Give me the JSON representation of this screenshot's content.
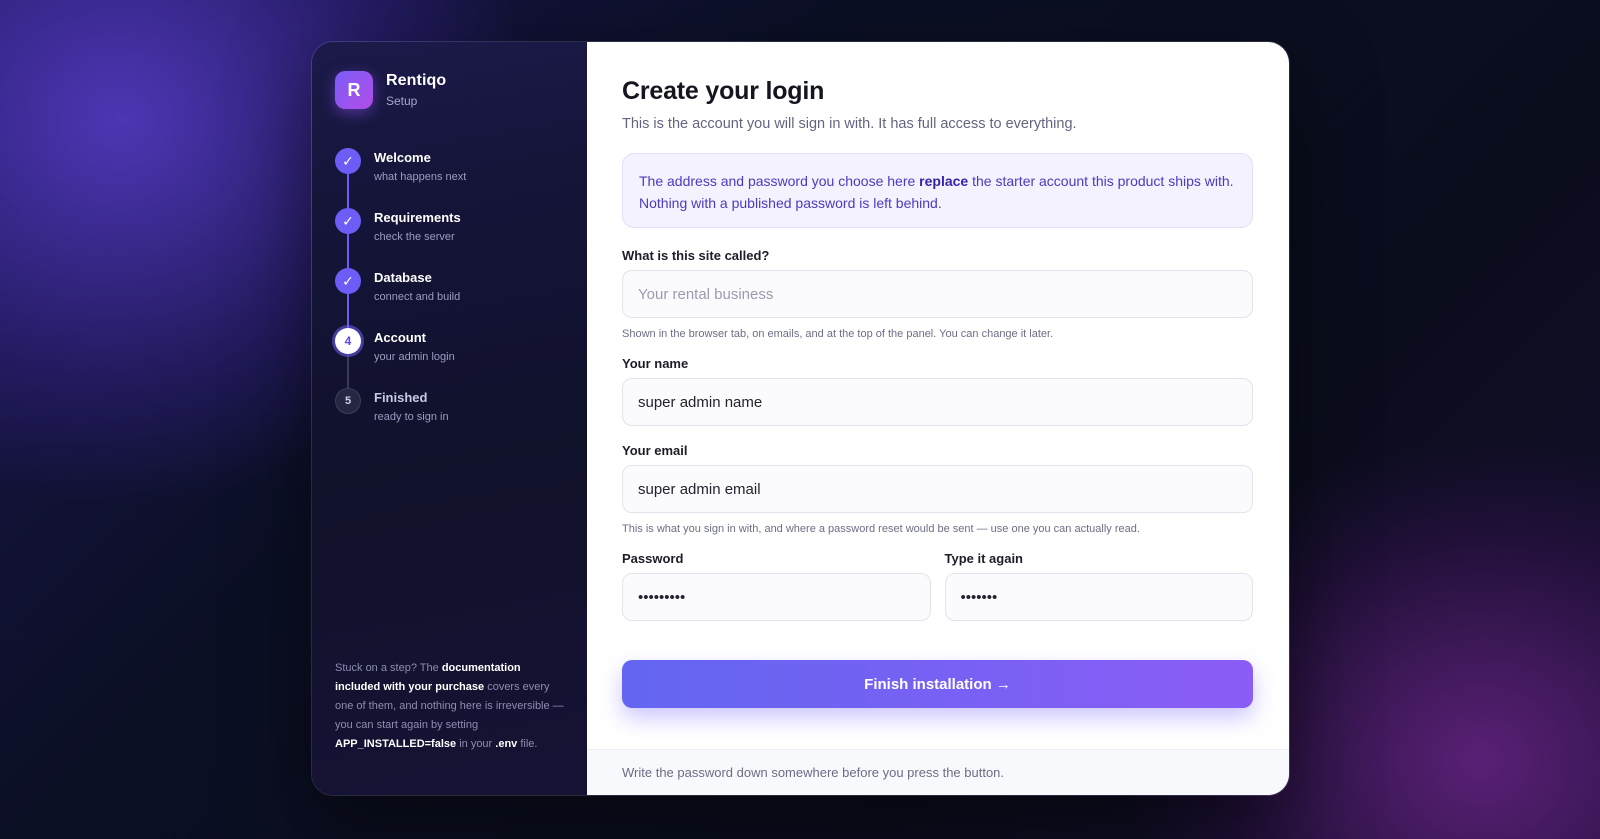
{
  "brand": {
    "logo_letter": "R",
    "name": "Rentiqo",
    "sub": "Setup"
  },
  "steps": [
    {
      "marker": "✓",
      "title": "Welcome",
      "sub": "what happens next"
    },
    {
      "marker": "✓",
      "title": "Requirements",
      "sub": "check the server"
    },
    {
      "marker": "✓",
      "title": "Database",
      "sub": "connect and build"
    },
    {
      "marker": "4",
      "title": "Account",
      "sub": "your admin login"
    },
    {
      "marker": "5",
      "title": "Finished",
      "sub": "ready to sign in"
    }
  ],
  "help": {
    "t1": "Stuck on a step? The ",
    "b1": "documentation included with your purchase",
    "t2": " covers every one of them, and nothing here is irreversible — you can start again by setting ",
    "b2": "APP_INSTALLED=false",
    "t3": " in your ",
    "b3": ".env",
    "t4": " file."
  },
  "main": {
    "title": "Create your login",
    "subtitle": "This is the account you will sign in with. It has full access to everything.",
    "notice": {
      "t1": "The address and password you choose here ",
      "b1": "replace",
      "t2": " the starter account this product ships with. Nothing with a published password is left behind."
    },
    "site_name": {
      "label": "What is this site called?",
      "placeholder": "Your rental business",
      "value": "",
      "hint": "Shown in the browser tab, on emails, and at the top of the panel. You can change it later."
    },
    "your_name": {
      "label": "Your name",
      "value": "super admin name"
    },
    "your_email": {
      "label": "Your email",
      "value": "super admin email",
      "hint": "This is what you sign in with, and where a password reset would be sent — use one you can actually read."
    },
    "password": {
      "label": "Password",
      "value": "123456789"
    },
    "password_confirm": {
      "label": "Type it again",
      "value": "1234567"
    },
    "submit_label": "Finish installation →",
    "footer": "Write the password down somewhere before you press the button."
  },
  "colors": {
    "accent": "#6d5cf5",
    "accent_end": "#8b5cf6",
    "sidebar_bg": "#13132f"
  }
}
